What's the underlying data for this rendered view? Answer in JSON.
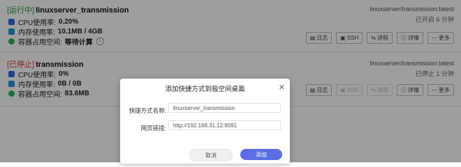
{
  "containers": [
    {
      "status": "[运行中]",
      "name": "linuxserver_transmission",
      "image": "linuxserver/transmission:latest",
      "uptime": "已开启 6 分钟",
      "cpu_label": "CPU使用率:",
      "cpu_value": "0.20%",
      "mem_label": "内存使用率:",
      "mem_value": "10.1MB / 4GB",
      "disk_label": "容器占用空间:",
      "disk_value": "等待计算"
    },
    {
      "status": "[已停止]",
      "name": "transmission",
      "image": "linuxserver/transmission:latest",
      "uptime": "已停止 1 分钟",
      "cpu_label": "CPU使用率:",
      "cpu_value": "0%",
      "mem_label": "内存使用率:",
      "mem_value": "0B / 0B",
      "disk_label": "容器占用空间:",
      "disk_value": "83.6MB"
    }
  ],
  "actions": {
    "log": "日志",
    "ssh": "SSH",
    "process": "进程",
    "detail": "详情",
    "more": "更多"
  },
  "modal": {
    "title": "添加快捷方式到极空间桌面",
    "name_label": "快捷方式名称:",
    "name_value": "linuxserver_transmission",
    "url_label": "网页链接:",
    "url_value": "http://192.168.31.12:9091",
    "cancel": "取消",
    "confirm": "添加"
  },
  "colors": {
    "running": "#2b9a3a",
    "stopped": "#d64242",
    "primary": "#5b6ee6"
  }
}
